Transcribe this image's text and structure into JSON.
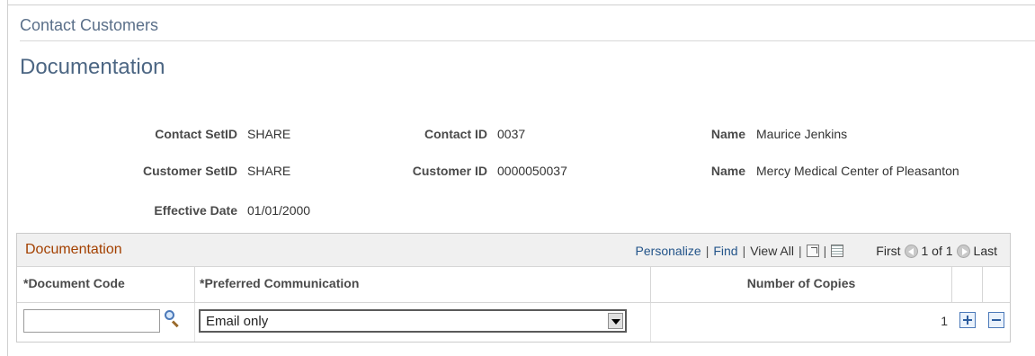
{
  "breadcrumb": "Contact Customers",
  "page_title": "Documentation",
  "header_fields": {
    "contact_setid": {
      "label": "Contact SetID",
      "value": "SHARE"
    },
    "contact_id": {
      "label": "Contact ID",
      "value": "0037"
    },
    "contact_name": {
      "label": "Name",
      "value": "Maurice Jenkins"
    },
    "customer_setid": {
      "label": "Customer SetID",
      "value": "SHARE"
    },
    "customer_id": {
      "label": "Customer ID",
      "value": "0000050037"
    },
    "customer_name": {
      "label": "Name",
      "value": "Mercy Medical Center of Pleasanton"
    },
    "effective_date": {
      "label": "Effective Date",
      "value": "01/01/2000"
    }
  },
  "grid": {
    "title": "Documentation",
    "nav": {
      "personalize": "Personalize",
      "find": "Find",
      "view_all": "View All",
      "first": "First",
      "range": "1 of 1",
      "last": "Last"
    },
    "columns": [
      "*Document Code",
      "*Preferred Communication",
      "Number of Copies"
    ],
    "rows": [
      {
        "document_code": "",
        "preferred_communication": "Email only",
        "number_of_copies": "1"
      }
    ]
  },
  "icons": {
    "lookup": "magnifier-icon",
    "zoom": "new-window-icon",
    "download": "spreadsheet-icon",
    "prev": "left-arrow-circle-icon",
    "next": "right-arrow-circle-icon",
    "add_row": "plus-icon",
    "delete_row": "minus-icon"
  },
  "colors": {
    "title": "#4c6683",
    "grid_title": "#a34000",
    "link": "#24558a"
  }
}
